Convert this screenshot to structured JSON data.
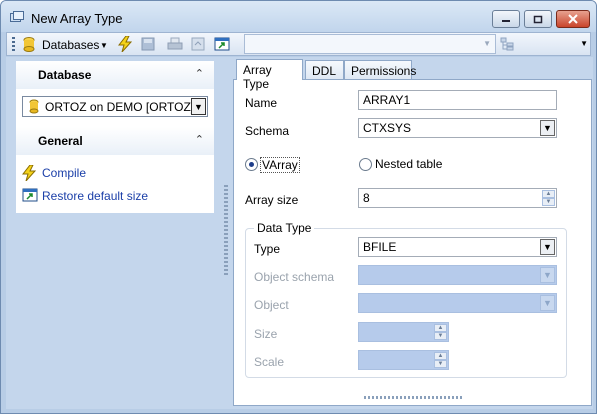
{
  "window": {
    "title": "New Array Type"
  },
  "toolbar": {
    "databases_label": "Databases",
    "combo_value": ""
  },
  "left": {
    "database_header": "Database",
    "database_value": "ORTOZ on DEMO [ORTOZ]",
    "general_header": "General",
    "links": [
      "Compile",
      "Restore default size"
    ]
  },
  "tabs": [
    "Array Type",
    "DDL",
    "Permissions"
  ],
  "form": {
    "name_label": "Name",
    "name_value": "ARRAY1",
    "schema_label": "Schema",
    "schema_value": "CTXSYS",
    "varray_label": "VArray",
    "nested_label": "Nested table",
    "array_size_label": "Array size",
    "array_size_value": "8",
    "group_label": "Data Type",
    "type_label": "Type",
    "type_value": "BFILE",
    "object_schema_label": "Object schema",
    "object_label": "Object",
    "size_label": "Size",
    "scale_label": "Scale"
  }
}
